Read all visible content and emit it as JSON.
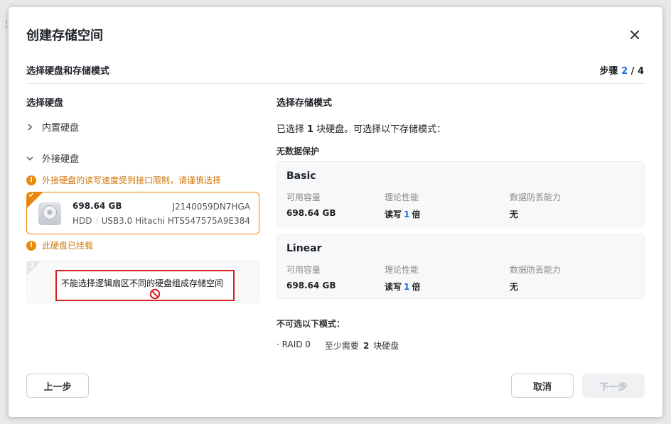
{
  "dialog": {
    "title": "创建存储空间",
    "subtitle": "选择硬盘和存储模式",
    "step_label": "步骤",
    "step_current": "2",
    "step_sep": "/",
    "step_total": "4"
  },
  "left": {
    "section_title": "选择硬盘",
    "internal_label": "内置硬盘",
    "external_label": "外接硬盘",
    "external_warning": "外接硬盘的读写速度受到接口限制，请谨慎选择",
    "disk1": {
      "capacity": "698.64 GB",
      "serial": "J2140059DN7HGA",
      "type": "HDD",
      "interface": "USB3.0",
      "model": "Hitachi HTS547575A9E384",
      "selected_mark": "✔"
    },
    "mounted_warning": "此硬盘已挂载",
    "disk2": {
      "index": "2"
    },
    "tooltip": "不能选择逻辑扇区不同的硬盘组成存储空间"
  },
  "right": {
    "section_title": "选择存储模式",
    "selected_prefix": "已选择",
    "selected_count": "1",
    "selected_suffix": "块硬盘。可选择以下存储模式：",
    "group_no_protection": "无数据保护",
    "modes": [
      {
        "name": "Basic",
        "capacity_label": "可用容量",
        "capacity": "698.64 GB",
        "perf_label": "理论性能",
        "perf_prefix": "读写",
        "perf_value": "1",
        "perf_suffix": "倍",
        "tolerance_label": "数据防丢能力",
        "tolerance": "无"
      },
      {
        "name": "Linear",
        "capacity_label": "可用容量",
        "capacity": "698.64 GB",
        "perf_label": "理论性能",
        "perf_prefix": "读写",
        "perf_value": "1",
        "perf_suffix": "倍",
        "tolerance_label": "数据防丢能力",
        "tolerance": "无"
      }
    ],
    "unavailable_title": "不可选以下模式：",
    "unavailable": [
      {
        "name": "· RAID 0",
        "req_prefix": "至少需要",
        "req_value": "2",
        "req_suffix": "块硬盘"
      }
    ]
  },
  "buttons": {
    "prev": "上一步",
    "cancel": "取消",
    "next": "下一步"
  },
  "icons": {
    "close": "close-icon",
    "warning": "warning-icon",
    "disk": "hdd-icon",
    "ban": "ban-icon"
  },
  "colors": {
    "accent": "#1a6fd6",
    "warning": "#e8860c",
    "error_border": "#d51f1f"
  }
}
